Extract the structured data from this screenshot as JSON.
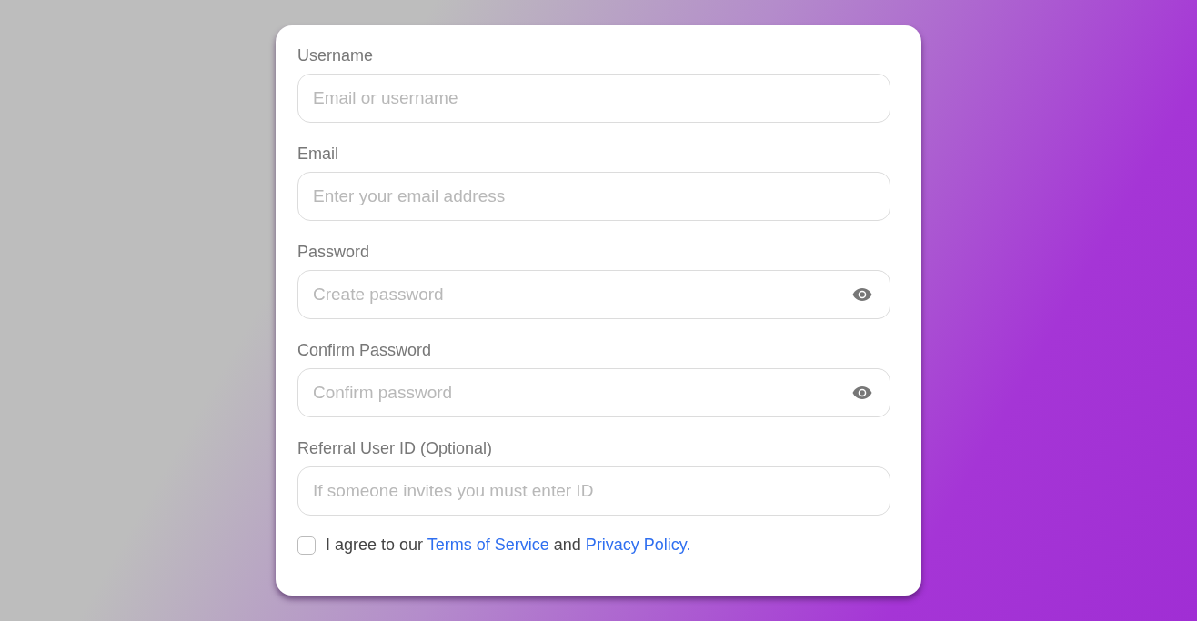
{
  "fields": [
    {
      "label": "Username",
      "placeholder": "Email or username",
      "kind": "text"
    },
    {
      "label": "Email",
      "placeholder": "Enter your email address",
      "kind": "text"
    },
    {
      "label": "Password",
      "placeholder": "Create password",
      "kind": "password"
    },
    {
      "label": "Confirm Password",
      "placeholder": "Confirm password",
      "kind": "password"
    },
    {
      "label": "Referral User ID (Optional)",
      "placeholder": "If someone invites you must enter ID",
      "kind": "text"
    }
  ],
  "agreement": {
    "checked": false,
    "parts": [
      {
        "kind": "text",
        "text": "I agree to our "
      },
      {
        "kind": "link",
        "text": "Terms of Service"
      },
      {
        "kind": "text",
        "text": " and "
      },
      {
        "kind": "link",
        "text": "Privacy Policy."
      }
    ]
  }
}
